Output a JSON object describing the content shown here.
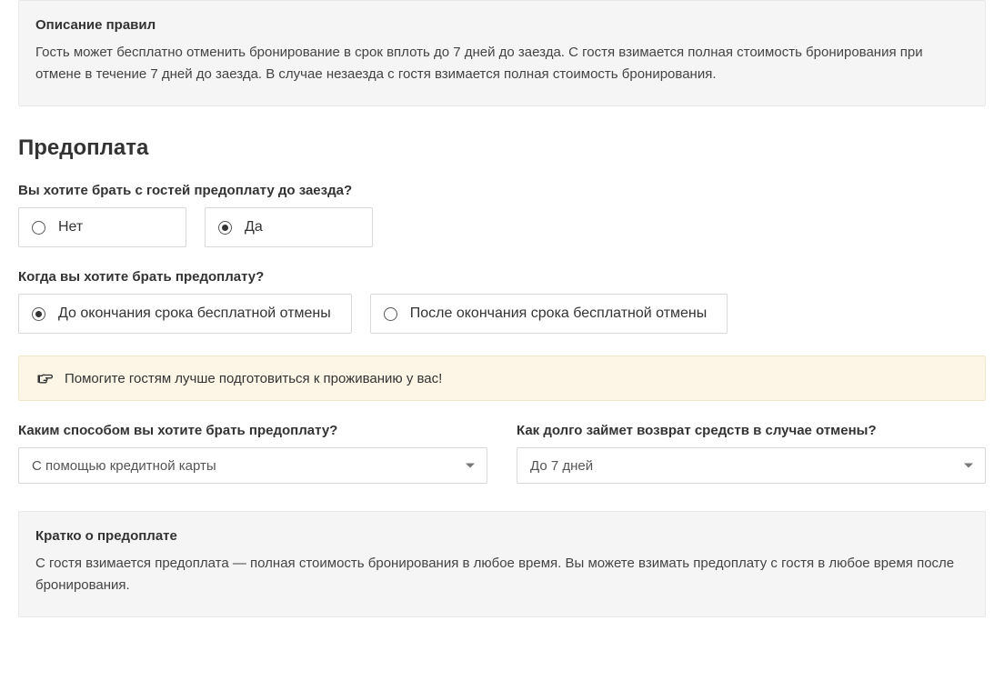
{
  "rules_panel": {
    "title": "Описание правил",
    "body": "Гость может бесплатно отменить бронирование в срок вплоть до 7 дней до заезда. С гостя взимается полная стоимость бронирования при отмене в течение 7 дней до заезда. В случае незаезда с гостя взимается полная стоимость бронирования."
  },
  "section_title": "Предоплата",
  "q_take_prepay": {
    "label": "Вы хотите брать с гостей предоплату до заезда?",
    "options": {
      "no": "Нет",
      "yes": "Да"
    },
    "selected": "yes"
  },
  "q_when_prepay": {
    "label": "Когда вы хотите брать предоплату?",
    "options": {
      "before_free_cancel": "До окончания срока бесплатной отмены",
      "after_free_cancel": "После окончания срока бесплатной отмены"
    },
    "selected": "before_free_cancel"
  },
  "hint": {
    "text": "Помогите гостям лучше подготовиться к проживанию у вас!"
  },
  "q_prepay_method": {
    "label": "Каким способом вы хотите брать предоплату?",
    "selected": "С помощью кредитной карты"
  },
  "q_refund_time": {
    "label": "Как долго займет возврат средств в случае отмены?",
    "selected": "До 7 дней"
  },
  "summary_panel": {
    "title": "Кратко о предоплате",
    "body": "С гостя взимается предоплата — полная стоимость бронирования в любое время. Вы можете взимать предоплату с гостя в любое время после бронирования."
  }
}
